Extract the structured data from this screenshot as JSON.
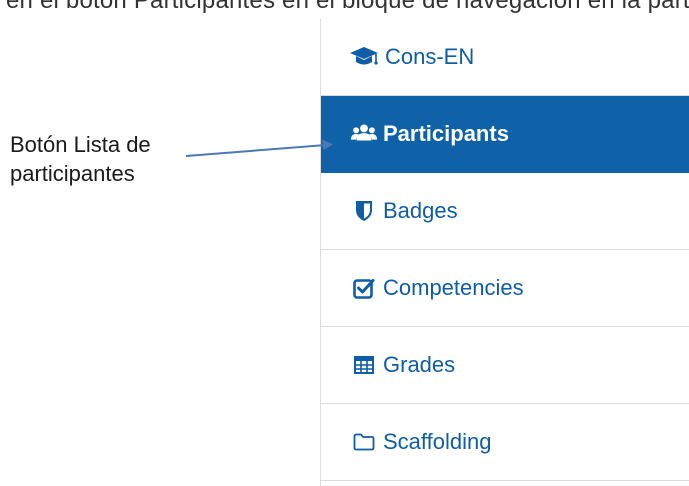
{
  "top_cut_text": "en el botón Participantes en el bloque de navegación en la parte izquierda",
  "annotation": {
    "line1": "Botón Lista de",
    "line2": "participantes"
  },
  "nav": {
    "items": [
      {
        "label": "Cons-EN",
        "icon": "graduation-cap-icon"
      },
      {
        "label": "Participants",
        "icon": "users-icon",
        "active": true
      },
      {
        "label": "Badges",
        "icon": "shield-icon"
      },
      {
        "label": "Competencies",
        "icon": "check-square-icon"
      },
      {
        "label": "Grades",
        "icon": "table-icon"
      },
      {
        "label": "Scaffolding",
        "icon": "folder-icon"
      }
    ]
  },
  "colors": {
    "link": "#0f5da6",
    "active_bg": "#0f62a8",
    "border": "#dcdcdc",
    "arrow": "#4a7ab5"
  }
}
